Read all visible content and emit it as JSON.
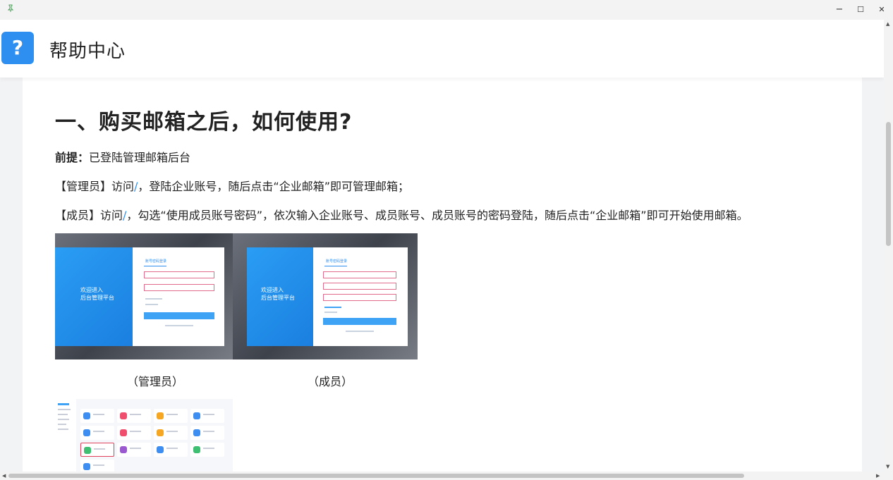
{
  "window": {
    "pin_icon": "pin-icon",
    "minimize": "−",
    "maximize": "☐",
    "close": "✕"
  },
  "header": {
    "logo_glyph": "?",
    "title": "帮助中心"
  },
  "article": {
    "heading": "一、购买邮箱之后，如何使用?",
    "premise_label": "前提：",
    "premise_text": "已登陆管理邮箱后台",
    "admin_prefix": "【管理员】访问",
    "admin_link": "/",
    "admin_suffix": "，登陆企业账号，随后点击“企业邮箱”即可管理邮箱；",
    "member_prefix": "【成员】访问",
    "member_link": "/",
    "member_suffix": "，勾选“使用成员账号密码”，依次输入企业账号、成员账号、成员账号的密码登陆，随后点击“企业邮箱”即可开始使用邮箱。",
    "caption_admin": "（管理员）",
    "caption_member": "（成员）",
    "shot_welcome_line1": "欢迎进入",
    "shot_welcome_line2": "后台管理平台",
    "shot_tab_label": "账号密码登录"
  },
  "colors": {
    "accent": "#2f8ff0",
    "header_bg": "#ffffff",
    "page_bg": "#f2f3f5"
  }
}
